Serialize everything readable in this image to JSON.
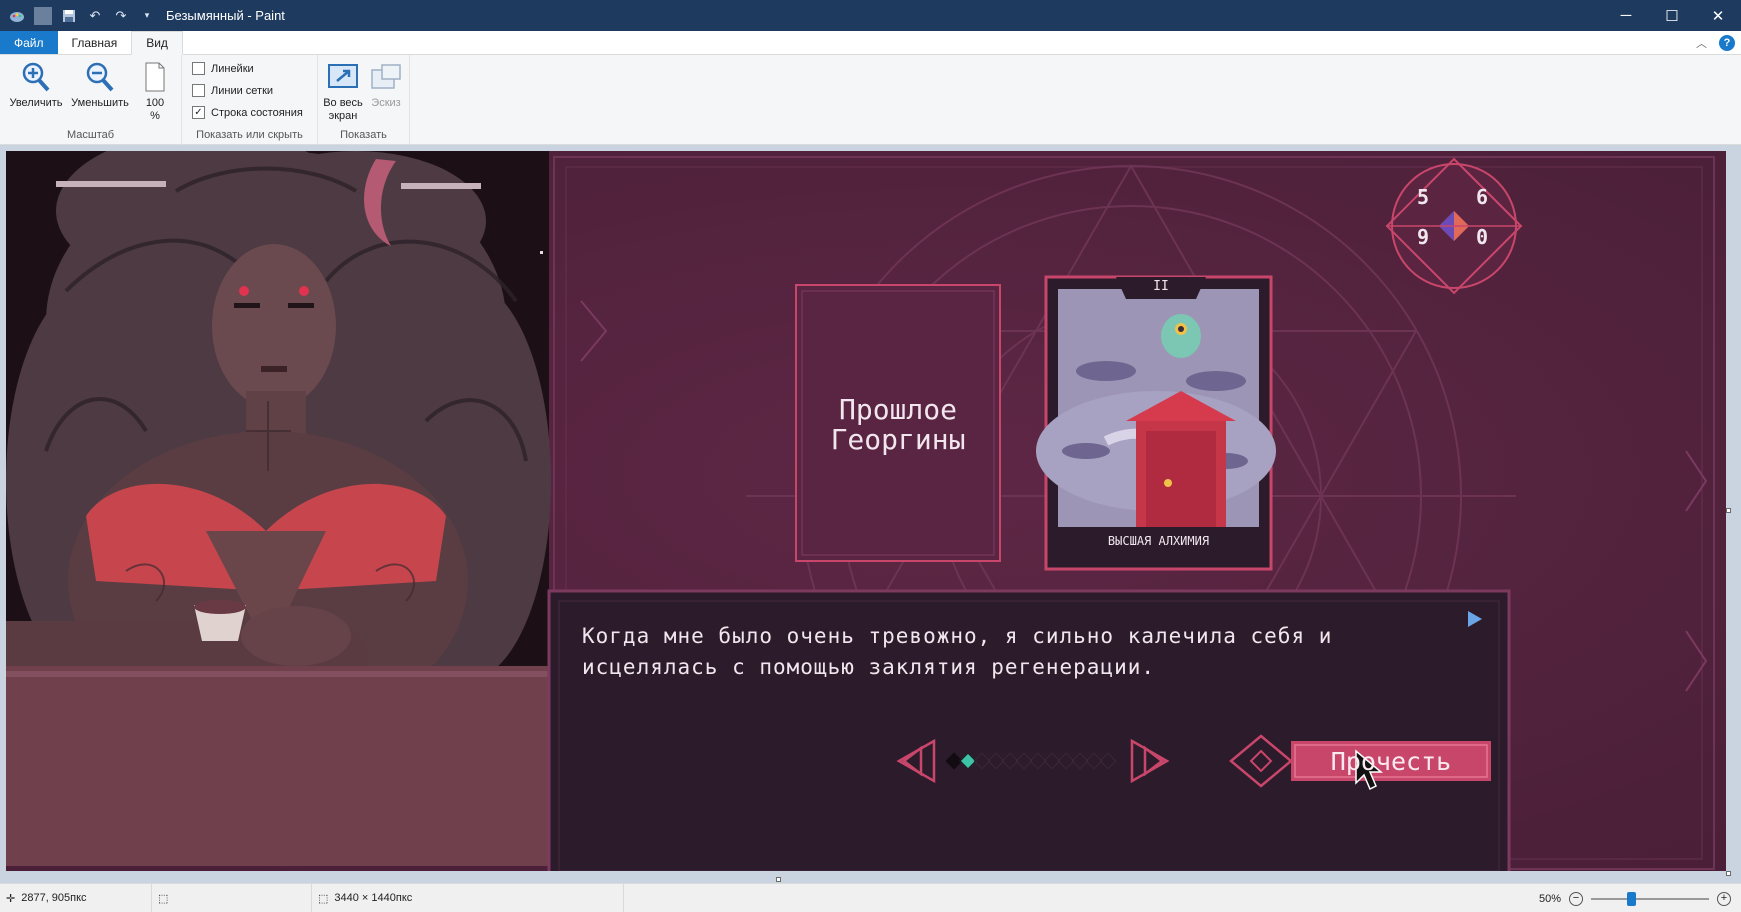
{
  "window": {
    "title": "Безымянный - Paint",
    "buttons": {
      "minimize": "─",
      "maximize": "☐",
      "close": "✕"
    }
  },
  "tabs": [
    {
      "label": "Файл"
    },
    {
      "label": "Главная"
    },
    {
      "label": "Вид"
    }
  ],
  "ribbon": {
    "groups": {
      "zoom": {
        "label": "Масштаб",
        "zoom_in": "Увеличить",
        "zoom_out": "Уменьшить",
        "zoom_100_line1": "100",
        "zoom_100_line2": "%"
      },
      "show_hide": {
        "label": "Показать или скрыть",
        "rulers": {
          "label": "Линейки",
          "checked": false
        },
        "gridlines": {
          "label": "Линии сетки",
          "checked": false
        },
        "statusbar": {
          "label": "Строка состояния",
          "checked": true
        }
      },
      "display": {
        "label": "Показать",
        "fullscreen_line1": "Во весь",
        "fullscreen_line2": "экран",
        "thumbnail": "Эскиз"
      }
    }
  },
  "game": {
    "counters": [
      "5",
      "6",
      "9",
      "0"
    ],
    "card_frame_label_line1": "Прошлое",
    "card_frame_label_line2": "Георгины",
    "card_numeral": "II",
    "card_name": "ВЫСШАЯ АЛХИМИЯ",
    "dialog_line1": "Когда мне было очень тревожно, я сильно калечила себя и",
    "dialog_line2": "исцелялась с помощью заклятия регенерации.",
    "read_button": "Прочесть",
    "progress": {
      "current": 2,
      "total": 12
    },
    "colors": {
      "bg": "#55243f",
      "accent": "#c9466b",
      "panel": "#2c1b2a",
      "teal": "#3fc3a7"
    }
  },
  "status": {
    "cursor_pos": "2877, 905пкс",
    "image_size": "3440 × 1440пкс",
    "zoom_label": "50%",
    "zoom_percent": 50
  }
}
